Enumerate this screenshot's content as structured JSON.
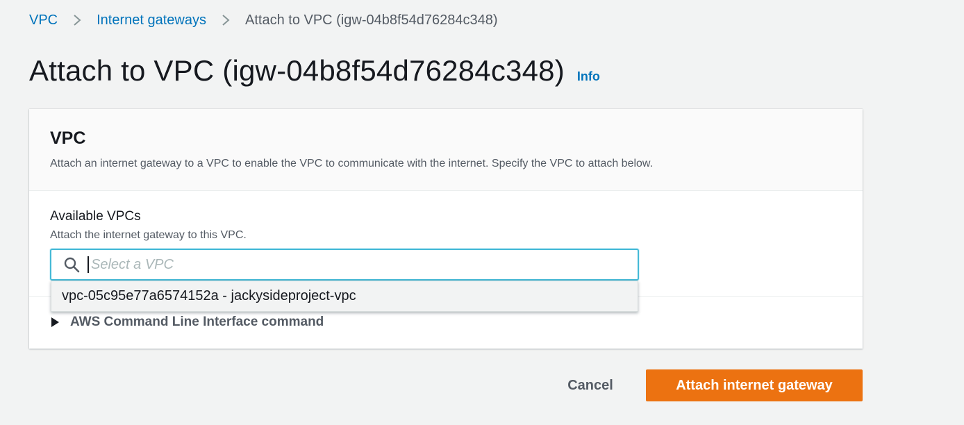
{
  "breadcrumb": {
    "items": [
      "VPC",
      "Internet gateways"
    ],
    "current": "Attach to VPC (igw-04b8f54d76284c348)"
  },
  "page": {
    "title": "Attach to VPC (igw-04b8f54d76284c348)",
    "info_link": "Info"
  },
  "panel": {
    "title": "VPC",
    "description": "Attach an internet gateway to a VPC to enable the VPC to communicate with the internet. Specify the VPC to attach below."
  },
  "field": {
    "label": "Available VPCs",
    "description": "Attach the internet gateway to this VPC.",
    "placeholder": "Select a VPC",
    "value": ""
  },
  "dropdown": {
    "options": [
      "vpc-05c95e77a6574152a - jackysideproject-vpc"
    ]
  },
  "cli": {
    "label": "AWS Command Line Interface command"
  },
  "footer": {
    "cancel_label": "Cancel",
    "submit_label": "Attach internet gateway"
  },
  "colors": {
    "link": "#0073bb",
    "primary_button": "#ec7211",
    "focus_border": "#44b9d6",
    "page_background": "#f2f3f3"
  },
  "icons": {
    "breadcrumb_separator": "chevron-right-icon",
    "search": "search-icon",
    "expand": "caret-right-icon"
  }
}
